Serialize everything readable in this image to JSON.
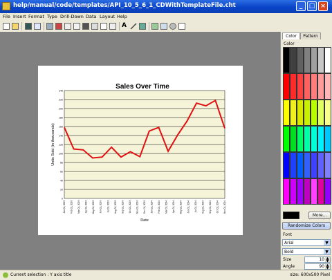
{
  "window": {
    "title": "help/manual/code/templates/API_10_5_6_1_CDWithTemplateFile.cht"
  },
  "menu": [
    "File",
    "Insert",
    "Format",
    "Type",
    "Drill-Down",
    "Data",
    "Layout",
    "Help"
  ],
  "chart_data": {
    "type": "line",
    "title": "Sales Over Time",
    "xlabel": "Date",
    "ylabel": "Units Sold (in thousands)",
    "ylim": [
      0,
      240
    ],
    "yticks": [
      0,
      20,
      40,
      60,
      80,
      100,
      120,
      140,
      160,
      180,
      200,
      220,
      240
    ],
    "grid": true,
    "legend": false,
    "categories": [
      "Jan 01, 2003",
      "Feb 01, 2003",
      "Mar 01, 2003",
      "Apr 01, 2003",
      "May 01, 2003",
      "Jun 01, 2003",
      "Jul 01, 2003",
      "Aug 01, 2003",
      "Sep 01, 2003",
      "Oct 01, 2003",
      "Nov 01, 2003",
      "Dec 01, 2003",
      "Jan 01, 2004",
      "Feb 01, 2004",
      "Mar 01, 2004",
      "Apr 01, 2004",
      "May 01, 2004",
      "Jun 01, 2004",
      "Jul 01, 2004",
      "Aug 01, 2004",
      "Sep 01, 2004",
      "Oct 01, 2004",
      "Nov 01, 2004"
    ],
    "values": [
      158,
      110,
      108,
      90,
      92,
      114,
      92,
      104,
      93,
      150,
      158,
      105,
      141,
      172,
      212,
      206,
      218,
      156
    ],
    "colors": {
      "line": "#e01010",
      "plot_bg": "#f6f4d8",
      "grid": "#000000"
    }
  },
  "panel": {
    "tabs": [
      "Color",
      "Pattern"
    ],
    "color_label": "Color",
    "swatch_rows": [
      [
        "#000000",
        "#404040",
        "#606060",
        "#808080",
        "#a0a0a0",
        "#c8c8c8",
        "#ffffff"
      ],
      [
        "#ff0000",
        "#ff2a2a",
        "#ff4040",
        "#ff6060",
        "#ff7d7d",
        "#ff9a9a",
        "#ffb6b6"
      ],
      [
        "#ffff00",
        "#f0f020",
        "#d8e800",
        "#c8f000",
        "#b8ff00",
        "#e0ff60",
        "#f8ff90"
      ],
      [
        "#00ff00",
        "#00e020",
        "#00ff66",
        "#00ffaa",
        "#00ffd8",
        "#00f0ff",
        "#00c8ff"
      ],
      [
        "#0000ff",
        "#2040ff",
        "#0060ff",
        "#3060ff",
        "#4040ff",
        "#6060ff",
        "#8080ff"
      ],
      [
        "#ff00ff",
        "#d000ff",
        "#a000ff",
        "#c000c0",
        "#ff40ff",
        "#e000a0",
        "#9000ff"
      ]
    ],
    "selected_color": "#000000",
    "more_label": "More...",
    "randomize_label": "Randomize Colors",
    "font_label": "Font",
    "font_family": "Arial",
    "font_style": "Bold",
    "size_label": "Size",
    "size_value": "10",
    "angle_label": "Angle",
    "angle_value": "90"
  },
  "status": {
    "left": "Current selection : Y axis title",
    "right": "size: 600x500 Pixel"
  }
}
